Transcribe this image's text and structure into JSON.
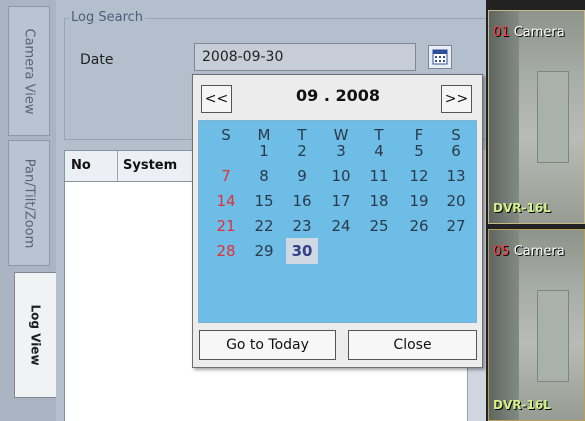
{
  "tabs": [
    {
      "label": "Camera View",
      "active": false
    },
    {
      "label": "Pan/Tilt/Zoom",
      "active": false
    },
    {
      "label": "Log View",
      "active": true
    }
  ],
  "log_search": {
    "group_title": "Log Search",
    "date_label": "Date",
    "date_value": "2008-09-30"
  },
  "log_table": {
    "columns": [
      "No",
      "System"
    ]
  },
  "calendar": {
    "prev_label": "<<",
    "next_label": ">>",
    "month_label": "09 . 2008",
    "day_headers": [
      "S",
      "M",
      "T",
      "W",
      "T",
      "F",
      "S"
    ],
    "weeks": [
      [
        "",
        "1",
        "2",
        "3",
        "4",
        "5",
        "6"
      ],
      [
        "7",
        "8",
        "9",
        "10",
        "11",
        "12",
        "13"
      ],
      [
        "14",
        "15",
        "16",
        "17",
        "18",
        "19",
        "20"
      ],
      [
        "21",
        "22",
        "23",
        "24",
        "25",
        "26",
        "27"
      ],
      [
        "28",
        "29",
        "30",
        "",
        "",
        "",
        ""
      ]
    ],
    "selected_day": "30",
    "today_button": "Go to Today",
    "close_button": "Close",
    "colors": {
      "grid": "#6dbde6",
      "sunday": "#e0303a"
    }
  },
  "cameras": [
    {
      "number": "01",
      "title": "Camera",
      "dvr": "DVR-16L"
    },
    {
      "number": "05",
      "title": "Camera",
      "dvr": "DVR-16L"
    }
  ]
}
